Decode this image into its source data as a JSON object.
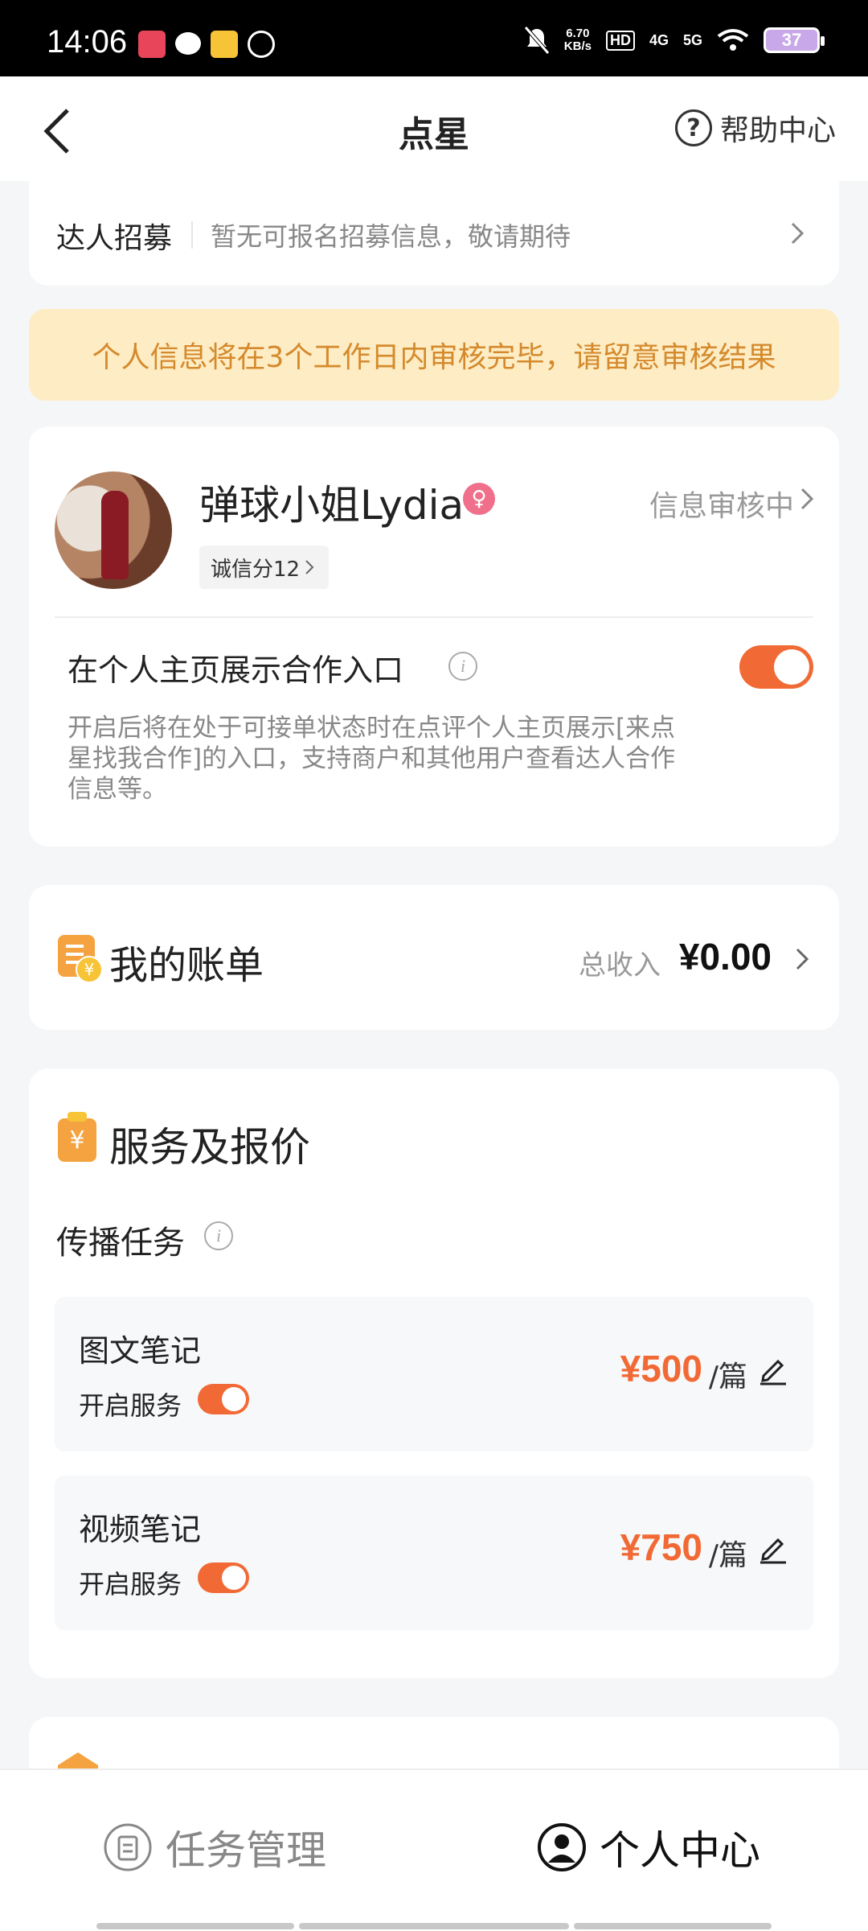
{
  "status_bar": {
    "time": "14:06",
    "net_speed_value": "6.70",
    "net_speed_unit": "KB/s",
    "hd": "HD",
    "net1": "4G",
    "net2": "5G",
    "battery": "37"
  },
  "nav": {
    "title": "点星",
    "help_label": "帮助中心"
  },
  "recruit": {
    "label": "达人招募",
    "text": "暂无可报名招募信息，敬请期待"
  },
  "notice": "个人信息将在3个工作日内审核完毕，请留意审核结果",
  "profile": {
    "name": "弹球小姐Lydia",
    "status": "信息审核中",
    "credit": "诚信分12",
    "entry_title": "在个人主页展示合作入口",
    "entry_enabled": true,
    "entry_desc": "开启后将在处于可接单状态时在点评个人主页展示[来点星找我合作]的入口，支持商户和其他用户查看达人合作信息等。"
  },
  "bill": {
    "title": "我的账单",
    "income_label": "总收入",
    "amount": "¥0.00"
  },
  "services": {
    "title": "服务及报价",
    "section": "传播任务",
    "items": [
      {
        "name": "图文笔记",
        "service_label": "开启服务",
        "enabled": true,
        "price": "¥500",
        "unit": "/篇"
      },
      {
        "name": "视频笔记",
        "service_label": "开启服务",
        "enabled": true,
        "price": "¥750",
        "unit": "/篇"
      }
    ]
  },
  "tabs": [
    {
      "label": "任务管理",
      "active": false
    },
    {
      "label": "个人中心",
      "active": true
    }
  ],
  "colors": {
    "accent": "#f16a35",
    "notice_bg": "#feecc4",
    "notice_text": "#d48a2c",
    "icon_orange": "#f4a340"
  }
}
